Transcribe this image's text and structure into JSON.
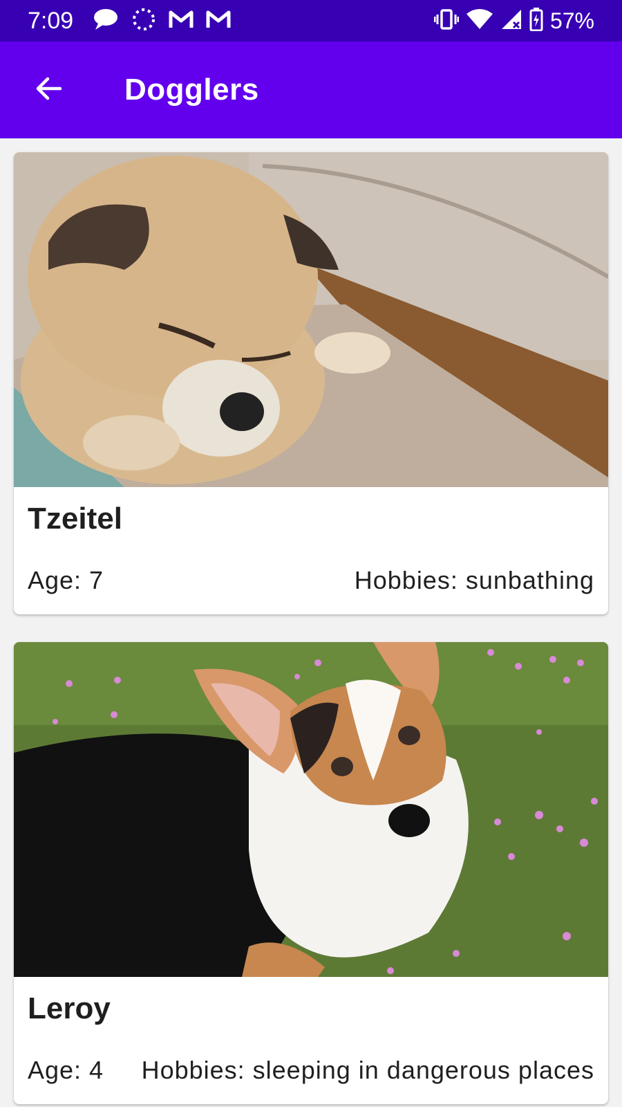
{
  "status_bar": {
    "time": "7:09",
    "battery_percent": "57%",
    "background": "#3700b3",
    "left_icons": [
      "chat-bubble-icon",
      "loading-dots-icon",
      "gmail-icon",
      "gmail-icon"
    ],
    "right_icons": [
      "vibrate-icon",
      "wifi-icon",
      "signal-icon",
      "battery-charging-icon"
    ]
  },
  "app_bar": {
    "title": "Dogglers",
    "back_icon": "arrow-back-icon",
    "background": "#6200ee"
  },
  "dogs": [
    {
      "name": "Tzeitel",
      "age": "Age: 7",
      "hobbies": "Hobbies: sunbathing"
    },
    {
      "name": "Leroy",
      "age": "Age: 4",
      "hobbies": "Hobbies: sleeping in dangerous places"
    }
  ]
}
